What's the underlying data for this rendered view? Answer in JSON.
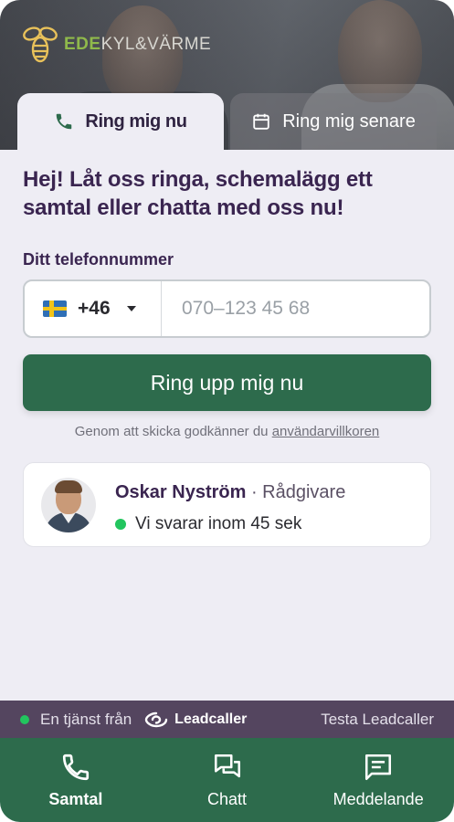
{
  "brand": {
    "logo_accent": "EDE",
    "logo_rest": "KYL&VÄRME",
    "logo_color_accent": "#8fb94b"
  },
  "tabs": [
    {
      "label": "Ring mig nu",
      "icon": "phone-icon",
      "active": true
    },
    {
      "label": "Ring mig senare",
      "icon": "calendar-icon",
      "active": false
    }
  ],
  "main": {
    "headline": "Hej! Låt oss ringa, schemalägg ett samtal eller chatta med oss nu!",
    "phone_label": "Ditt telefonnummer",
    "country_code": "+46",
    "country_flag": "sweden-flag-icon",
    "phone_placeholder": "070–123 45 68",
    "phone_value": "",
    "cta_label": "Ring upp mig nu",
    "terms_prefix": "Genom att skicka godkänner du ",
    "terms_link": "användarvillkoren"
  },
  "agent": {
    "name": "Oskar Nyström",
    "role": " · Rådgivare",
    "status": "Vi svarar inom 45 sek",
    "status_color": "#22c55e"
  },
  "footer": {
    "service_text": "En tjänst från",
    "brand_name": "Leadcaller",
    "try_text": "Testa Leadcaller"
  },
  "bottom_nav": [
    {
      "label": "Samtal",
      "icon": "phone-icon",
      "active": true
    },
    {
      "label": "Chatt",
      "icon": "chat-icon",
      "active": false
    },
    {
      "label": "Meddelande",
      "icon": "message-icon",
      "active": false
    }
  ],
  "colors": {
    "primary_green": "#2d6b4c",
    "headline_purple": "#3a2550",
    "footer_strip": "#54455f",
    "background": "#eeedf4"
  }
}
